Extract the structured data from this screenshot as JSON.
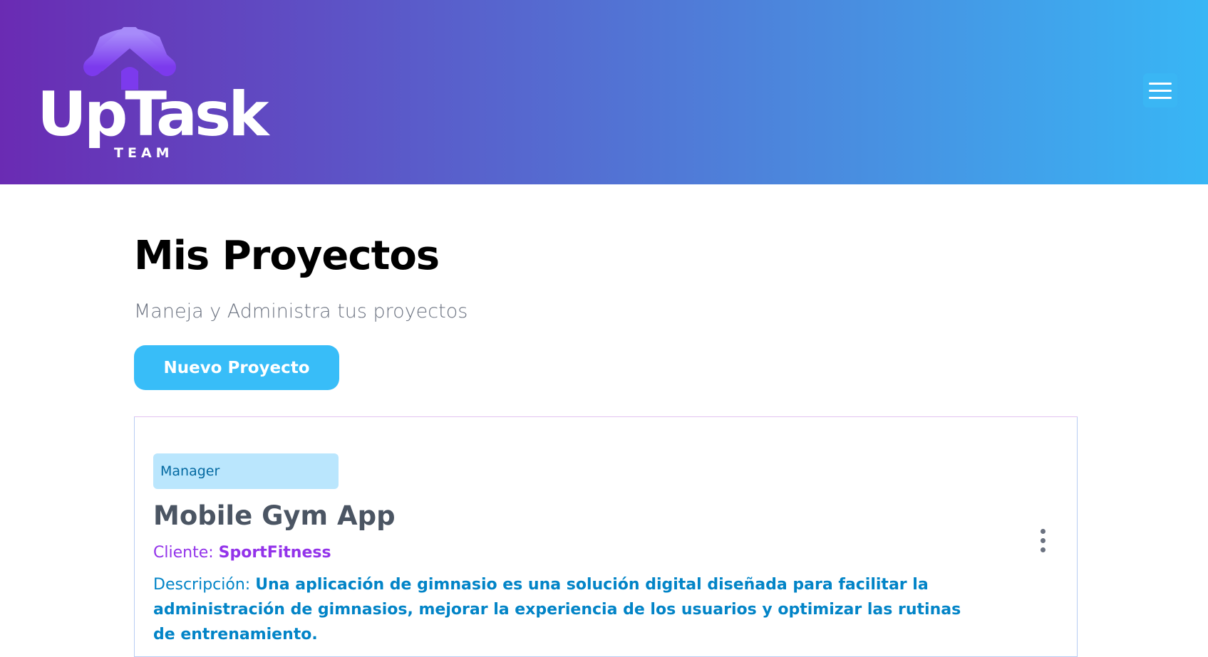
{
  "brand": {
    "name": "UpTask",
    "tagline": "TEAM"
  },
  "header": {
    "menu_icon": "hamburger-menu-icon"
  },
  "page": {
    "title": "Mis Proyectos",
    "subtitle": "Maneja y Administra tus proyectos",
    "new_project_label": "Nuevo Proyecto"
  },
  "projects": [
    {
      "role": "Manager",
      "name": "Mobile Gym App",
      "client_label": "Cliente:",
      "client": "SportFitness",
      "description_label": "Descripción:",
      "description": "Una aplicación de gimnasio es una solución digital diseñada para facilitar la administración de gimnasios, mejorar la experiencia de los usuarios y optimizar las rutinas de entrenamiento.",
      "options_icon": "vertical-ellipsis-icon"
    }
  ],
  "colors": {
    "header_gradient_start": "#6a2bb3",
    "header_gradient_end": "#38b6f5",
    "primary_button": "#38bdf8",
    "badge_background": "#bae6fd",
    "badge_text": "#0369a1",
    "client_text": "#9333ea",
    "description_text": "#0284c7"
  }
}
